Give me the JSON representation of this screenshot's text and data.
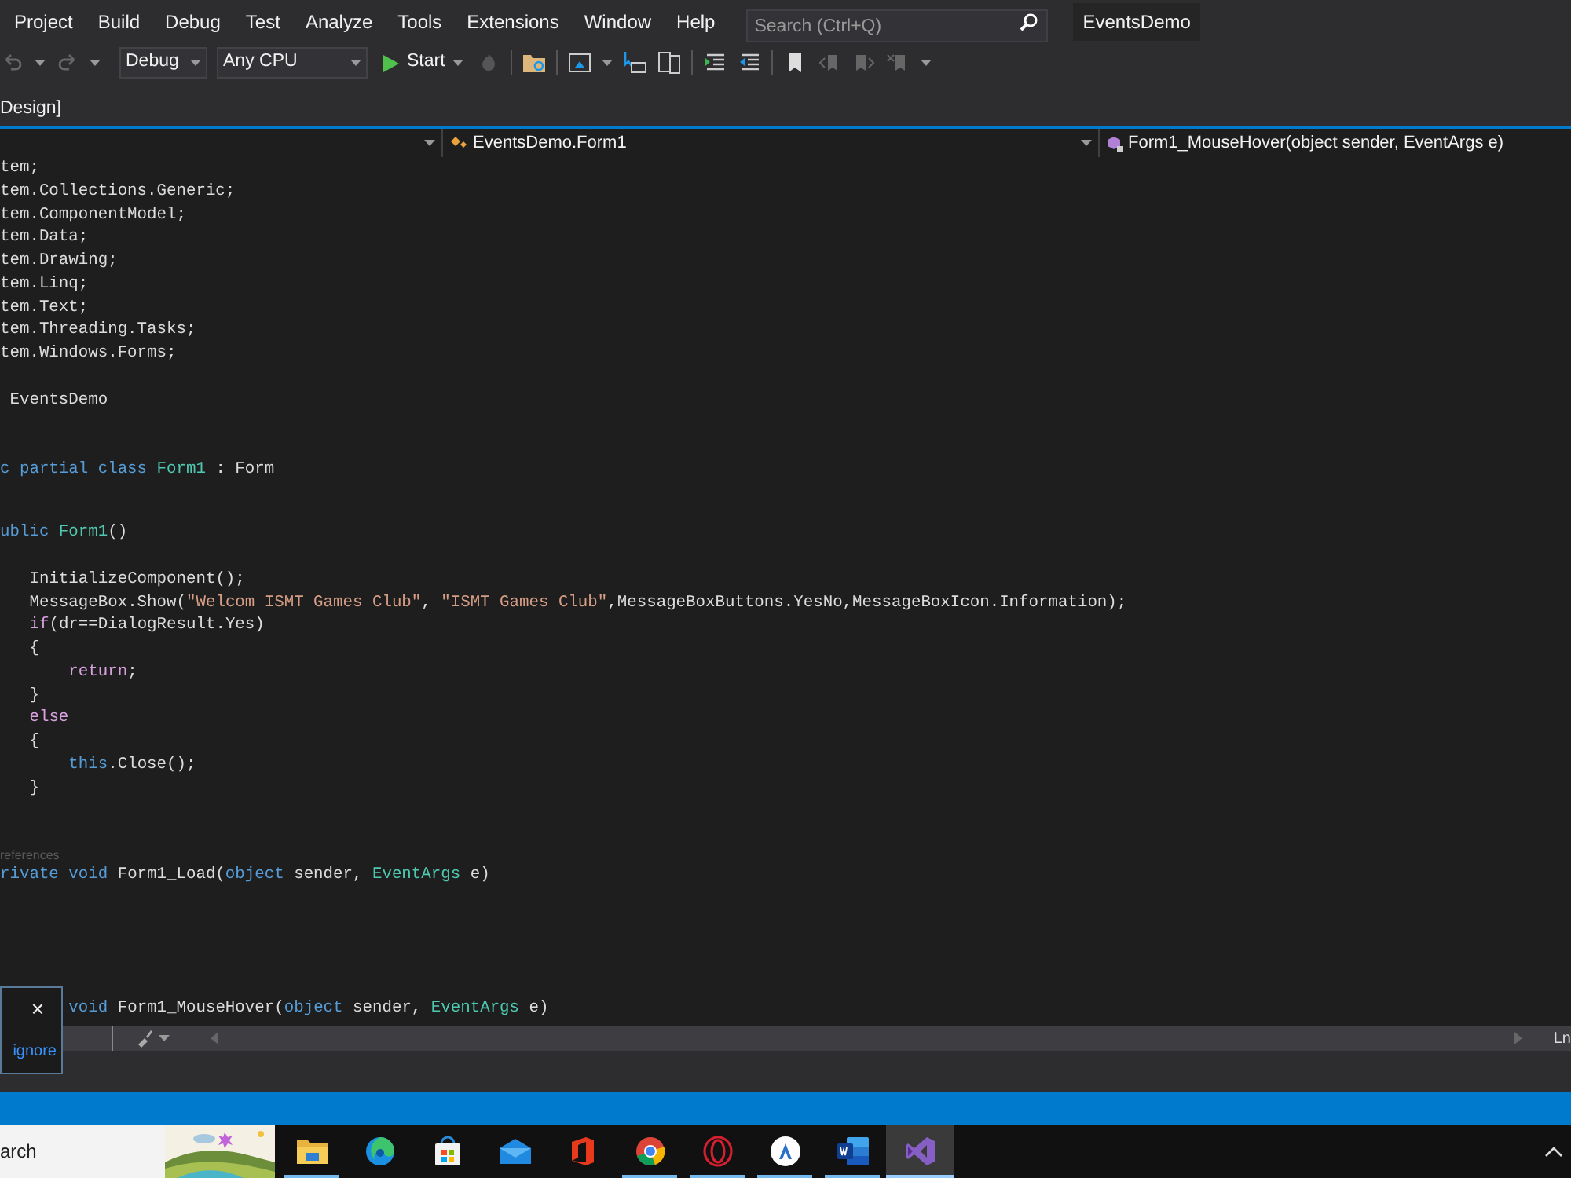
{
  "menu": [
    "Project",
    "Build",
    "Debug",
    "Test",
    "Analyze",
    "Tools",
    "Extensions",
    "Window",
    "Help"
  ],
  "search": {
    "placeholder": "Search (Ctrl+Q)"
  },
  "window": {
    "title": "EventsDemo"
  },
  "toolbar": {
    "configuration": "Debug",
    "platform": "Any CPU",
    "start": "Start"
  },
  "document_tab": {
    "label": "Design]"
  },
  "navigation": {
    "type_dropdown": "EventsDemo.Form1",
    "member_dropdown": "Form1_MouseHover(object sender, EventArgs e)"
  },
  "code_lines": [
    {
      "kind": "code",
      "tokens": [
        {
          "t": "tem;",
          "kind": "plain"
        }
      ]
    },
    {
      "kind": "code",
      "tokens": [
        {
          "t": "tem.Collections.Generic;",
          "kind": "plain"
        }
      ]
    },
    {
      "kind": "code",
      "tokens": [
        {
          "t": "tem.ComponentModel;",
          "kind": "plain"
        }
      ]
    },
    {
      "kind": "code",
      "tokens": [
        {
          "t": "tem.Data;",
          "kind": "plain"
        }
      ]
    },
    {
      "kind": "code",
      "tokens": [
        {
          "t": "tem.Drawing;",
          "kind": "plain"
        }
      ]
    },
    {
      "kind": "code",
      "tokens": [
        {
          "t": "tem.Linq;",
          "kind": "plain"
        }
      ]
    },
    {
      "kind": "code",
      "tokens": [
        {
          "t": "tem.Text;",
          "kind": "plain"
        }
      ]
    },
    {
      "kind": "code",
      "tokens": [
        {
          "t": "tem.Threading.Tasks;",
          "kind": "plain"
        }
      ]
    },
    {
      "kind": "code",
      "tokens": [
        {
          "t": "tem.Windows.Forms;",
          "kind": "plain"
        }
      ]
    },
    {
      "kind": "blank"
    },
    {
      "kind": "code",
      "tokens": [
        {
          "t": " EventsDemo",
          "kind": "plain"
        }
      ]
    },
    {
      "kind": "blank"
    },
    {
      "kind": "blank"
    },
    {
      "kind": "code",
      "tokens": [
        {
          "t": "c partial class ",
          "kind": "keyword"
        },
        {
          "t": "Form1",
          "kind": "type"
        },
        {
          "t": " : Form",
          "kind": "plain"
        }
      ]
    },
    {
      "kind": "blank"
    },
    {
      "kind": "codelens"
    },
    {
      "kind": "code",
      "tokens": [
        {
          "t": "ublic ",
          "kind": "keyword"
        },
        {
          "t": "Form1",
          "kind": "type"
        },
        {
          "t": "()",
          "kind": "plain"
        }
      ]
    },
    {
      "kind": "blank"
    },
    {
      "kind": "code",
      "tokens": [
        {
          "t": "   InitializeComponent();",
          "kind": "plain"
        }
      ]
    },
    {
      "kind": "code",
      "tokens": [
        {
          "t": "   MessageBox.Show(",
          "kind": "plain"
        },
        {
          "t": "\"Welcom ISMT Games Club\"",
          "kind": "string"
        },
        {
          "t": ", ",
          "kind": "plain"
        },
        {
          "t": "\"ISMT Games Club\"",
          "kind": "string"
        },
        {
          "t": ",MessageBoxButtons.YesNo,MessageBoxIcon.Information);",
          "kind": "plain"
        }
      ]
    },
    {
      "kind": "code",
      "tokens": [
        {
          "t": "   if",
          "kind": "control"
        },
        {
          "t": "(dr==DialogResult.Yes)",
          "kind": "plain"
        }
      ]
    },
    {
      "kind": "code",
      "tokens": [
        {
          "t": "   {",
          "kind": "plain"
        }
      ]
    },
    {
      "kind": "code",
      "tokens": [
        {
          "t": "       return",
          "kind": "control"
        },
        {
          "t": ";",
          "kind": "plain"
        }
      ]
    },
    {
      "kind": "code",
      "tokens": [
        {
          "t": "   }",
          "kind": "plain"
        }
      ]
    },
    {
      "kind": "code",
      "tokens": [
        {
          "t": "   else",
          "kind": "control"
        }
      ]
    },
    {
      "kind": "code",
      "tokens": [
        {
          "t": "   {",
          "kind": "plain"
        }
      ]
    },
    {
      "kind": "code",
      "tokens": [
        {
          "t": "       this",
          "kind": "keyword"
        },
        {
          "t": ".Close();",
          "kind": "plain"
        }
      ]
    },
    {
      "kind": "code",
      "tokens": [
        {
          "t": "   }",
          "kind": "plain"
        }
      ]
    },
    {
      "kind": "blank"
    },
    {
      "kind": "blank"
    },
    {
      "kind": "codelens",
      "text": "references"
    },
    {
      "kind": "code",
      "tokens": [
        {
          "t": "rivate void",
          "kind": "keyword"
        },
        {
          "t": " Form1_Load(",
          "kind": "plain"
        },
        {
          "t": "object",
          "kind": "keyword"
        },
        {
          "t": " sender, ",
          "kind": "plain"
        },
        {
          "t": "EventArgs",
          "kind": "type"
        },
        {
          "t": " e)",
          "kind": "plain"
        }
      ]
    },
    {
      "kind": "blank"
    },
    {
      "kind": "blank"
    },
    {
      "kind": "blank"
    },
    {
      "kind": "blank"
    },
    {
      "kind": "codelens"
    },
    {
      "kind": "code",
      "tokens": [
        {
          "t": "       void",
          "kind": "keyword"
        },
        {
          "t": " Form1_MouseHover(",
          "kind": "plain"
        },
        {
          "t": "object",
          "kind": "keyword"
        },
        {
          "t": " sender, ",
          "kind": "plain"
        },
        {
          "t": "EventArgs",
          "kind": "type"
        },
        {
          "t": " e)",
          "kind": "plain"
        }
      ]
    }
  ],
  "notification": {
    "close": "×",
    "link": "ignore"
  },
  "scrollbar": {
    "position_label": "Ln"
  },
  "taskbar": {
    "search": {
      "placeholder": "arch"
    },
    "apps": [
      {
        "kind": "explorer",
        "running": true,
        "selected": false
      },
      {
        "kind": "edge",
        "running": false,
        "selected": false
      },
      {
        "kind": "store",
        "running": false,
        "selected": false
      },
      {
        "kind": "mail",
        "running": false,
        "selected": false
      },
      {
        "kind": "office",
        "running": false,
        "selected": false
      },
      {
        "kind": "chrome",
        "running": true,
        "selected": false
      },
      {
        "kind": "opera",
        "running": true,
        "selected": false
      },
      {
        "kind": "assistant",
        "running": true,
        "selected": false
      },
      {
        "kind": "word",
        "running": true,
        "selected": false
      },
      {
        "kind": "studio",
        "running": true,
        "selected": true
      }
    ]
  }
}
